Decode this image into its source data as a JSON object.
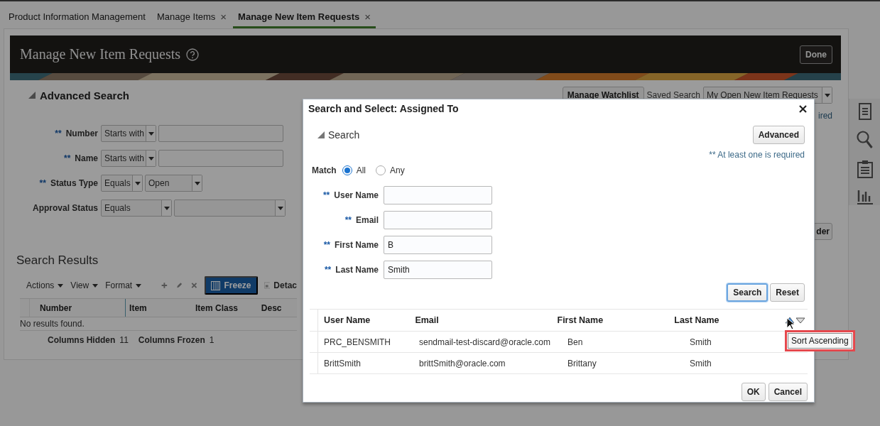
{
  "tabs": [
    {
      "label": "Product Information Management",
      "selected": false
    },
    {
      "label": "Manage Items",
      "selected": false,
      "close": "×"
    },
    {
      "label": "Manage New Item Requests",
      "selected": true,
      "close": "×"
    }
  ],
  "page": {
    "title": "Manage New Item Requests",
    "done_button": "Done"
  },
  "advanced_search": {
    "title": "Advanced Search",
    "expanded": true,
    "manage_watchlist_button": "Manage Watchlist",
    "saved_search_label": "Saved Search",
    "saved_search_value": "My Open New Item Requests",
    "required_note": "ired",
    "partial_button": "der",
    "fields": [
      {
        "marker": "**",
        "label": "Number",
        "operator": "Starts with",
        "kind": "text"
      },
      {
        "marker": "**",
        "label": "Name",
        "operator": "Starts with",
        "kind": "text"
      },
      {
        "marker": "**",
        "label": "Status Type",
        "operator": "Equals",
        "kind": "select",
        "value": "Open"
      },
      {
        "label": "Approval Status",
        "operator": "Equals",
        "kind": "select"
      }
    ]
  },
  "search_results": {
    "title": "Search Results",
    "menus": [
      "Actions",
      "View",
      "Format"
    ],
    "freeze_button": "Freeze",
    "detach_button": "Detac",
    "columns": [
      "Number",
      "Item",
      "Item Class",
      "Desc"
    ],
    "empty_message": "No results found.",
    "footer": [
      {
        "label": "Columns Hidden",
        "value": "11"
      },
      {
        "label": "Columns Frozen",
        "value": "1"
      }
    ]
  },
  "dialog": {
    "title": "Search and Select: Assigned To",
    "search_title": "Search",
    "expanded": true,
    "advanced_button": "Advanced",
    "required_note": "** At least one is required",
    "match_label": "Match",
    "match_options": [
      {
        "label": "All",
        "selected": true
      },
      {
        "label": "Any",
        "selected": false
      }
    ],
    "fields": [
      {
        "marker": "**",
        "label": "User Name"
      },
      {
        "marker": "**",
        "label": "Email"
      },
      {
        "marker": "**",
        "label": "First Name",
        "value": "B"
      },
      {
        "marker": "**",
        "label": "Last Name",
        "value": "Smith"
      }
    ],
    "search_buttons": [
      {
        "label": "Search",
        "focused": true
      },
      {
        "label": "Reset",
        "focused": false
      }
    ],
    "columns": [
      "User Name",
      "Email",
      "First Name",
      "Last Name"
    ],
    "rows": [
      [
        "PRC_BENSMITH",
        "sendmail-test-discard@oracle.com",
        "Ben",
        "Smith"
      ],
      [
        "BrittSmith",
        "brittSmith@oracle.com",
        "Brittany",
        "Smith"
      ]
    ],
    "tooltip": "Sort Ascending",
    "buttons": [
      "OK",
      "Cancel"
    ]
  }
}
